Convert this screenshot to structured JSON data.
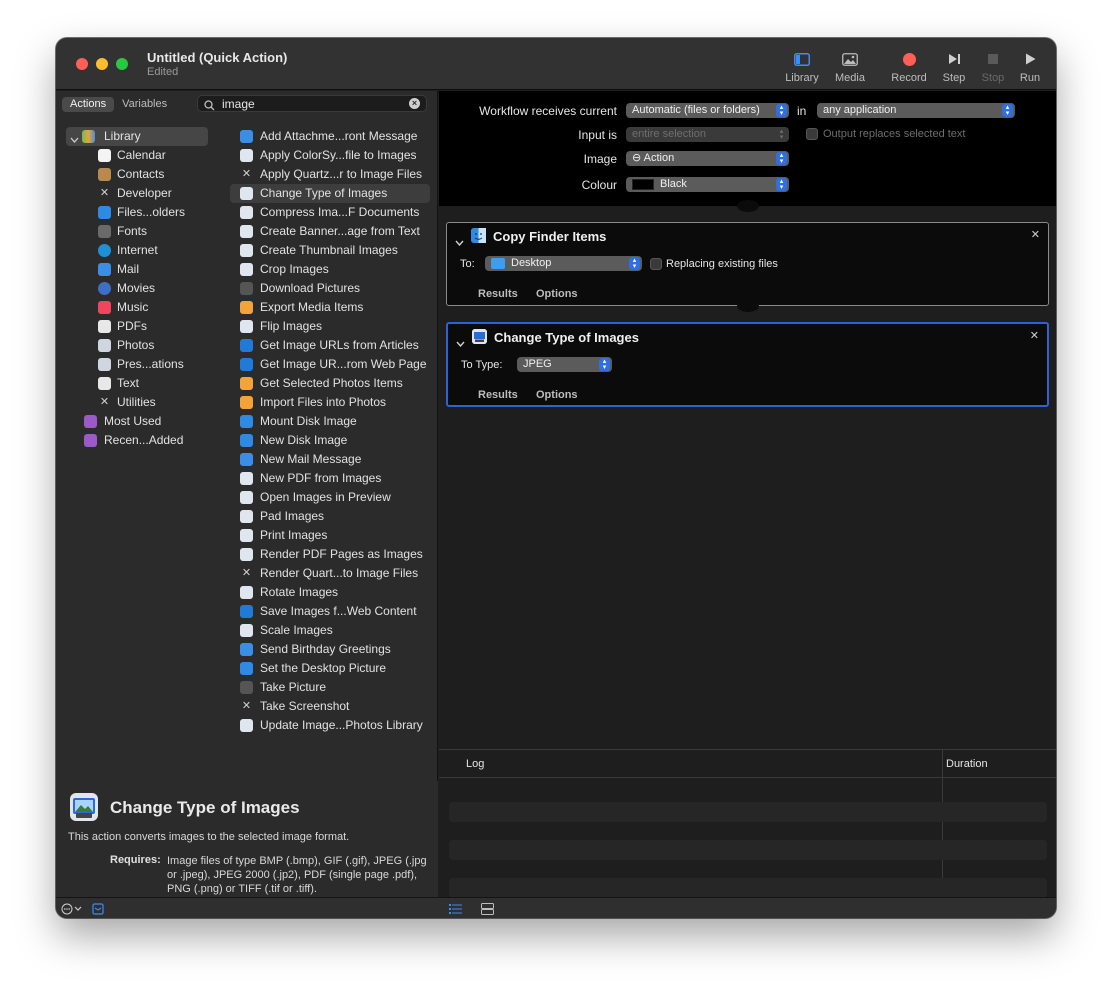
{
  "window": {
    "title": "Untitled (Quick Action)",
    "subtitle": "Edited"
  },
  "toolbar": {
    "library": "Library",
    "media": "Media",
    "record": "Record",
    "step": "Step",
    "stop": "Stop",
    "run": "Run"
  },
  "library": {
    "tabs": {
      "actions": "Actions",
      "variables": "Variables"
    },
    "search": {
      "value": "image"
    },
    "categories": [
      {
        "label": "Library",
        "icon": "library-icon"
      },
      {
        "label": "Calendar",
        "icon": "calendar-icon"
      },
      {
        "label": "Contacts",
        "icon": "contacts-icon"
      },
      {
        "label": "Developer",
        "icon": "developer-icon"
      },
      {
        "label": "Files...olders",
        "icon": "finder-icon"
      },
      {
        "label": "Fonts",
        "icon": "fonts-icon"
      },
      {
        "label": "Internet",
        "icon": "internet-icon"
      },
      {
        "label": "Mail",
        "icon": "mail-icon"
      },
      {
        "label": "Movies",
        "icon": "movies-icon"
      },
      {
        "label": "Music",
        "icon": "music-icon"
      },
      {
        "label": "PDFs",
        "icon": "pdf-icon"
      },
      {
        "label": "Photos",
        "icon": "photos-icon"
      },
      {
        "label": "Pres...ations",
        "icon": "presentations-icon"
      },
      {
        "label": "Text",
        "icon": "text-icon"
      },
      {
        "label": "Utilities",
        "icon": "utilities-icon"
      },
      {
        "label": "Most Used",
        "icon": "folder-icon"
      },
      {
        "label": "Recen...Added",
        "icon": "folder-icon"
      }
    ],
    "actions": [
      "Add Attachme...ront Message",
      "Apply ColorSy...file to Images",
      "Apply Quartz...r to Image Files",
      "Change Type of Images",
      "Compress Ima...F Documents",
      "Create Banner...age from Text",
      "Create Thumbnail Images",
      "Crop Images",
      "Download Pictures",
      "Export Media Items",
      "Flip Images",
      "Get Image URLs from Articles",
      "Get Image UR...rom Web Page",
      "Get Selected Photos Items",
      "Import Files into Photos",
      "Mount Disk Image",
      "New Disk Image",
      "New Mail Message",
      "New PDF from Images",
      "Open Images in Preview",
      "Pad Images",
      "Print Images",
      "Render PDF Pages as Images",
      "Render Quart...to Image Files",
      "Rotate Images",
      "Save Images f...Web Content",
      "Scale Images",
      "Send Birthday Greetings",
      "Set the Desktop Picture",
      "Take Picture",
      "Take Screenshot",
      "Update Image...Photos Library"
    ],
    "selected_action": "Change Type of Images"
  },
  "description": {
    "title": "Change Type of Images",
    "text": "This action converts images to the selected image format.",
    "requires_label": "Requires:",
    "requires_text": "Image files of type BMP (.bmp), GIF (.gif), JPEG (.jpg or .jpeg), JPEG 2000 (.jp2), PDF (single page .pdf), PNG (.png) or TIFF (.tif or .tiff)."
  },
  "workflow_header": {
    "receives_label": "Workflow receives current",
    "receives_value": "Automatic (files or folders)",
    "in_label": "in",
    "app_value": "any application",
    "input_label": "Input is",
    "input_value": "entire selection",
    "output_replaces": "Output replaces selected text",
    "image_label": "Image",
    "image_value": "⊖ Action",
    "colour_label": "Colour",
    "colour_value": "Black"
  },
  "cards": {
    "copy": {
      "title": "Copy Finder Items",
      "to_label": "To:",
      "to_value": "Desktop",
      "replacing": "Replacing existing files",
      "results": "Results",
      "options": "Options"
    },
    "change": {
      "title": "Change Type of Images",
      "to_type_label": "To Type:",
      "to_type_value": "JPEG",
      "results": "Results",
      "options": "Options"
    }
  },
  "log": {
    "col_log": "Log",
    "col_duration": "Duration"
  },
  "colors": {
    "accent": "#2c62d4",
    "record": "#fe5f57"
  }
}
